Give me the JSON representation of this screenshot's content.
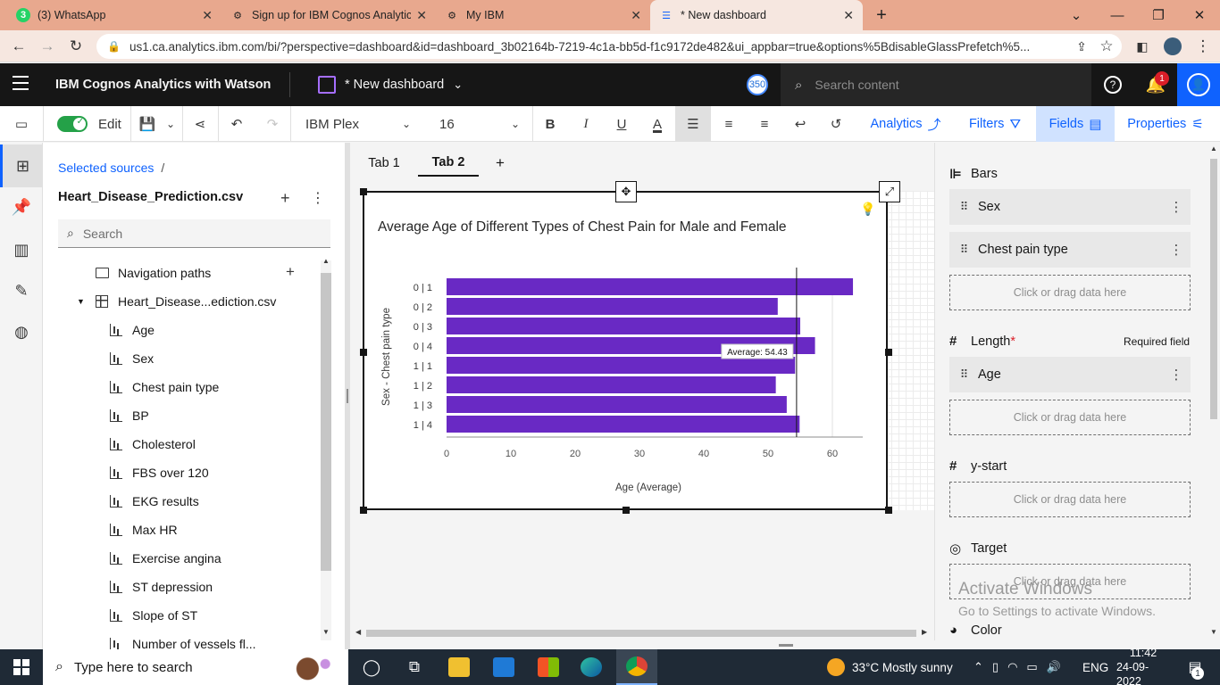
{
  "browser": {
    "tabs": [
      {
        "label": "(3) WhatsApp",
        "icon": "whatsapp-icon",
        "badge": "3"
      },
      {
        "label": "Sign up for IBM Cognos Analytic",
        "icon": "cognos-icon"
      },
      {
        "label": "My IBM",
        "icon": "cognos-icon"
      },
      {
        "label": "* New dashboard",
        "icon": "dashboard-icon",
        "active": true
      }
    ],
    "url": "us1.ca.analytics.ibm.com/bi/?perspective=dashboard&id=dashboard_3b02164b-7219-4c1a-bb5d-f1c9172de482&ui_appbar=true&options%5BdisableGlassPrefetch%5..."
  },
  "app": {
    "brand": "IBM Cognos Analytics with Watson",
    "dashboard_name": "* New dashboard",
    "counter_badge": "350",
    "search_placeholder": "Search content",
    "notification_count": "1"
  },
  "toolbar": {
    "edit_label": "Edit",
    "font_family": "IBM Plex",
    "font_size": "16",
    "analytics_label": "Analytics",
    "filters_label": "Filters",
    "fields_label": "Fields",
    "properties_label": "Properties"
  },
  "source_panel": {
    "breadcrumb": "Selected sources",
    "breadcrumb_sep": "/",
    "source_name": "Heart_Disease_Prediction.csv",
    "search_placeholder": "Search",
    "nav_paths": "Navigation paths",
    "table_name": "Heart_Disease...ediction.csv",
    "fields": [
      "Age",
      "Sex",
      "Chest pain type",
      "BP",
      "Cholesterol",
      "FBS over 120",
      "EKG results",
      "Max HR",
      "Exercise angina",
      "ST depression",
      "Slope of ST",
      "Number of vessels fl..."
    ]
  },
  "canvas": {
    "tabs": [
      "Tab 1",
      "Tab 2"
    ],
    "active_tab": 1,
    "add_tab": "+"
  },
  "chart_data": {
    "type": "bar",
    "orientation": "horizontal",
    "title": "Average Age of Different Types of Chest Pain for Male and Female",
    "categories": [
      "0 | 1",
      "0 | 2",
      "0 | 3",
      "0 | 4",
      "1 | 1",
      "1 | 2",
      "1 | 3",
      "1 | 4"
    ],
    "values": [
      63.2,
      51.5,
      55.0,
      57.3,
      54.2,
      51.2,
      52.9,
      54.9
    ],
    "xlabel": "Age (Average)",
    "ylabel": "Sex - Chest pain type",
    "xlim": [
      0,
      65
    ],
    "xticks": [
      0,
      10,
      20,
      30,
      40,
      50,
      60
    ],
    "average_line": {
      "value": 54.43,
      "label": "Average: 54.43"
    },
    "bar_color": "#6929c4"
  },
  "fields_panel": {
    "bars_label": "Bars",
    "bars_items": [
      "Sex",
      "Chest pain type"
    ],
    "drop_placeholder": "Click or drag data here",
    "length_label": "Length",
    "length_required": "*",
    "required_text": "Required field",
    "length_items": [
      "Age"
    ],
    "ystart_label": "y-start",
    "target_label": "Target",
    "color_label": "Color"
  },
  "watermark": {
    "line1": "Activate Windows",
    "line2": "Go to Settings to activate Windows."
  },
  "taskbar": {
    "search_placeholder": "Type here to search",
    "weather": "33°C  Mostly sunny",
    "lang": "ENG",
    "time": "11:42",
    "date": "24-09-2022",
    "notif_count": "1"
  }
}
